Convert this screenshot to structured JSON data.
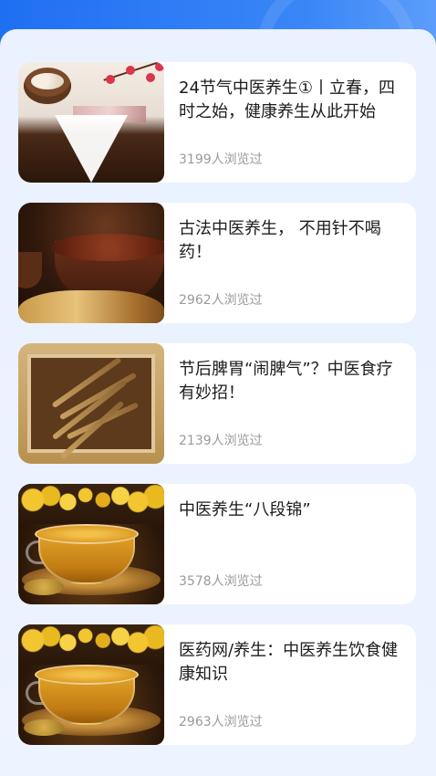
{
  "articles": [
    {
      "title": "24节气中医养生①丨立春，四时之始，健康养生从此开始",
      "views": "3199人浏览过",
      "image": "herbs-plum-blossom"
    },
    {
      "title": "古法中医养生，  不用针不喝药！",
      "views": "2962人浏览过",
      "image": "herb-bowls"
    },
    {
      "title": "节后脾胃“闹脾气”？中医食疗有妙招！",
      "views": "2139人浏览过",
      "image": "cordyceps-tray"
    },
    {
      "title": "中医养生“八段锦”",
      "views": "3578人浏览过",
      "image": "tea-cup"
    },
    {
      "title": "医药网/养生：中医养生饮食健康知识",
      "views": "2963人浏览过",
      "image": "tea-cup"
    }
  ]
}
